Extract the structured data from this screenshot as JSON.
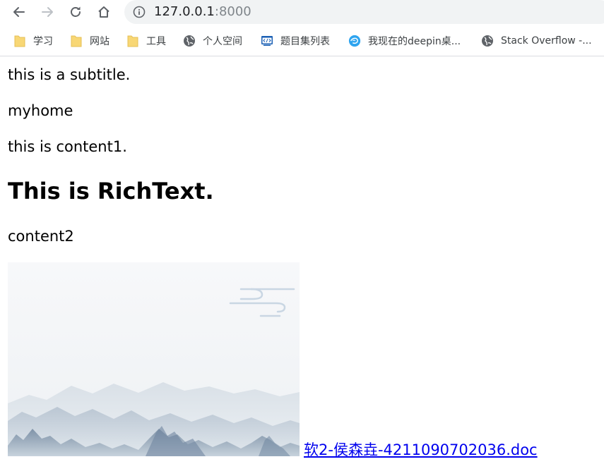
{
  "browser": {
    "url_host": "127.0.0.1",
    "url_port": ":8000",
    "back_icon": "arrow-left-icon",
    "forward_icon": "arrow-right-icon",
    "reload_icon": "reload-icon",
    "home_icon": "home-icon",
    "info_icon": "info-icon"
  },
  "bookmarks": [
    {
      "label": "学习",
      "icon": "folder-icon"
    },
    {
      "label": "网站",
      "icon": "folder-icon"
    },
    {
      "label": "工具",
      "icon": "folder-icon"
    },
    {
      "label": "个人空间",
      "icon": "globe-icon"
    },
    {
      "label": "题目集列表",
      "icon": "code-window-icon"
    },
    {
      "label": "我现在的deepin桌...",
      "icon": "deepin-logo-icon"
    },
    {
      "label": "Stack Overflow -...",
      "icon": "globe-icon"
    }
  ],
  "page": {
    "subtitle": "this is a subtitle.",
    "home": "myhome",
    "content1": "this is content1.",
    "rich_heading": "This is RichText.",
    "content2": "content2",
    "doc_link": "软2-侯森垚-4211090702036.doc"
  },
  "colors": {
    "link": "#0000ee",
    "folder": "#f8d775",
    "toolbar_bg": "#f1f3f4"
  }
}
